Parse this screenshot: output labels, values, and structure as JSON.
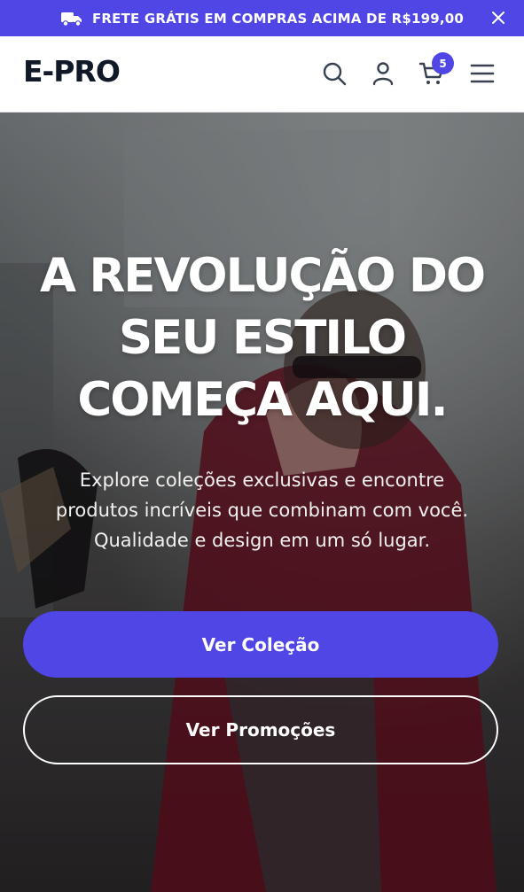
{
  "promo": {
    "text": "FRETE GRÁTIS EM COMPRAS ACIMA DE R$199,00",
    "icon": "truck-icon",
    "close_icon": "close-icon"
  },
  "header": {
    "logo": "E-PRO",
    "icons": [
      "search-icon",
      "user-icon",
      "cart-icon",
      "menu-icon"
    ],
    "cart_count": "5"
  },
  "hero": {
    "title_lines": [
      "A REVOLUÇÃO DO",
      "SEU ESTILO",
      "COMEÇA AQUI."
    ],
    "subtitle_lines": [
      "Explore coleções exclusivas e encontre",
      "produtos incríveis que combinam com você.",
      "Qualidade e design em um só lugar."
    ],
    "primary_button": "Ver Coleção",
    "secondary_button": "Ver Promoções"
  },
  "colors": {
    "accent": "#4f46e5",
    "text_dark": "#111827",
    "white": "#ffffff"
  }
}
